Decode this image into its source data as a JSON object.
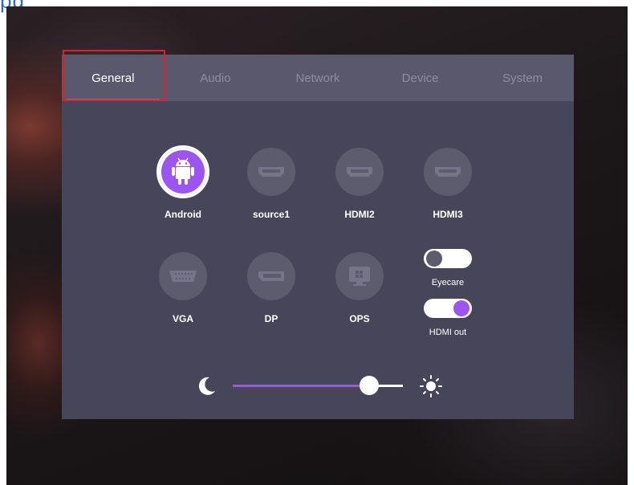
{
  "tabs": [
    {
      "label": "General",
      "active": true
    },
    {
      "label": "Audio",
      "active": false
    },
    {
      "label": "Network",
      "active": false
    },
    {
      "label": "Device",
      "active": false
    },
    {
      "label": "System",
      "active": false
    }
  ],
  "sources": [
    {
      "label": "Android",
      "icon": "android-icon",
      "active": true
    },
    {
      "label": "source1",
      "icon": "hdmi-port-icon",
      "active": false
    },
    {
      "label": "HDMI2",
      "icon": "hdmi-port-icon",
      "active": false
    },
    {
      "label": "HDMI3",
      "icon": "hdmi-port-icon",
      "active": false
    },
    {
      "label": "VGA",
      "icon": "vga-port-icon",
      "active": false
    },
    {
      "label": "DP",
      "icon": "displayport-icon",
      "active": false
    },
    {
      "label": "OPS",
      "icon": "ops-icon",
      "active": false
    }
  ],
  "toggles": {
    "eyecare": {
      "label": "Eyecare",
      "on": false
    },
    "hdmi_out": {
      "label": "HDMI out",
      "on": true
    }
  },
  "brightness": {
    "value_percent": 80,
    "min_icon": "moon-icon",
    "max_icon": "sun-icon"
  },
  "colors": {
    "accent": "#9c55f0",
    "panel": "#47455a",
    "tab_bar": "#5a586c",
    "highlight": "#d9232b"
  }
}
